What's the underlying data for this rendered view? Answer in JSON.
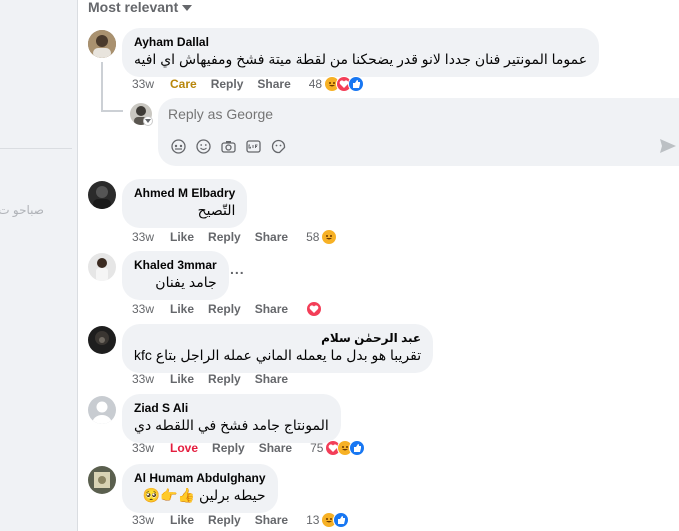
{
  "left_panel": {
    "partial_text": "صباحو ت"
  },
  "sort": {
    "label": "Most relevant"
  },
  "reply_box": {
    "placeholder": "Reply as George"
  },
  "comments": [
    {
      "author": "Ayham Dallal",
      "text": "عموما المونتير فنان جددا لانو قدر يضحكنا من لقطة ميتة فشخ ومفيهاش اي افيه",
      "time": "33w",
      "reaction_label": "Care",
      "reply": "Reply",
      "share": "Share",
      "count": "48",
      "emojis": [
        "haha",
        "love",
        "like"
      ]
    },
    {
      "author": "Ahmed M Elbadry",
      "text": "التّصيح",
      "time": "33w",
      "reaction_label": "Like",
      "reply": "Reply",
      "share": "Share",
      "count": "58",
      "emojis": [
        "haha"
      ]
    },
    {
      "author": "Khaled 3mmar",
      "text": "جامد يفنان",
      "time": "33w",
      "reaction_label": "Like",
      "reply": "Reply",
      "share": "Share",
      "count": "",
      "emojis": [
        "love"
      ],
      "more": "..."
    },
    {
      "author": "عبد الرحمٰن سلام",
      "text": "تقريبا هو بدل ما يعمله الماني عمله الراجل بتاع kfc",
      "time": "33w",
      "reaction_label": "Like",
      "reply": "Reply",
      "share": "Share",
      "count": "",
      "emojis": []
    },
    {
      "author": "Ziad S Ali",
      "text": "المونتاج جامد فشخ في اللقطه دي",
      "time": "33w",
      "reaction_label": "Love",
      "reply": "Reply",
      "share": "Share",
      "count": "75",
      "emojis": [
        "love",
        "haha",
        "like"
      ]
    },
    {
      "author": "Al Humam Abdulghany",
      "text": "حيطه برلين 👍👉🥺",
      "time": "33w",
      "reaction_label": "Like",
      "reply": "Reply",
      "share": "Share",
      "count": "13",
      "emojis": [
        "haha",
        "like"
      ]
    }
  ],
  "colors": {
    "like": "#1877f2",
    "love": "#f33e58",
    "care": "#f7b125",
    "bubble": "#f0f2f5",
    "meta": "#65676b"
  }
}
